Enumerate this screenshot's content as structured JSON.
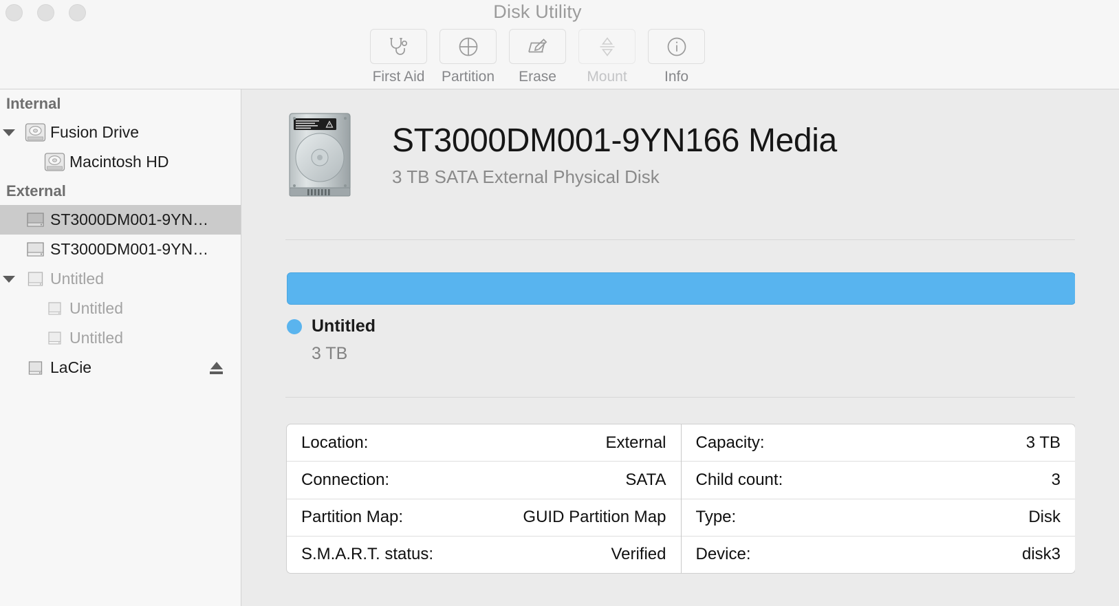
{
  "window": {
    "title": "Disk Utility",
    "traffic_lights": [
      "close-button",
      "minimize-button",
      "zoom-button"
    ]
  },
  "toolbar": {
    "items": [
      {
        "label": "First Aid",
        "icon": "stethoscope-icon",
        "enabled": true
      },
      {
        "label": "Partition",
        "icon": "pie-chart-icon",
        "enabled": true
      },
      {
        "label": "Erase",
        "icon": "erase-pencil-icon",
        "enabled": true
      },
      {
        "label": "Mount",
        "icon": "mount-arrows-icon",
        "enabled": false
      },
      {
        "label": "Info",
        "icon": "info-circle-icon",
        "enabled": true
      }
    ]
  },
  "sidebar": {
    "sections": [
      {
        "header": "Internal",
        "items": [
          {
            "label": "Fusion Drive",
            "indent": 0,
            "icon": "internal-disk-icon",
            "twisty": "expanded",
            "selected": false,
            "dim": false,
            "eject": false
          },
          {
            "label": "Macintosh HD",
            "indent": 1,
            "icon": "internal-volume-icon",
            "twisty": "none",
            "selected": false,
            "dim": false,
            "eject": false
          }
        ]
      },
      {
        "header": "External",
        "items": [
          {
            "label": "ST3000DM001-9YN…",
            "indent": 0,
            "icon": "external-disk-icon",
            "twisty": "none",
            "selected": true,
            "dim": false,
            "eject": false
          },
          {
            "label": "ST3000DM001-9YN…",
            "indent": 0,
            "icon": "external-disk-icon",
            "twisty": "none",
            "selected": false,
            "dim": false,
            "eject": false
          },
          {
            "label": "Untitled",
            "indent": 0,
            "icon": "external-volume-icon",
            "twisty": "expanded",
            "selected": false,
            "dim": true,
            "eject": false
          },
          {
            "label": "Untitled",
            "indent": 1,
            "icon": "external-volume-icon",
            "twisty": "none",
            "selected": false,
            "dim": true,
            "eject": false
          },
          {
            "label": "Untitled",
            "indent": 1,
            "icon": "external-volume-icon",
            "twisty": "none",
            "selected": false,
            "dim": true,
            "eject": false
          },
          {
            "label": "LaCie",
            "indent": 0,
            "icon": "external-volume-icon",
            "twisty": "none",
            "selected": false,
            "dim": false,
            "eject": true
          }
        ]
      }
    ]
  },
  "main": {
    "disk_title": "ST3000DM001-9YN166 Media",
    "disk_subtitle": "3 TB SATA External Physical Disk",
    "capacity": {
      "bar_color": "#5ab4ee",
      "segments": [
        {
          "name": "Untitled",
          "size": "3 TB",
          "percent": 100,
          "color": "#5ab4ee"
        }
      ]
    },
    "info": {
      "left": [
        {
          "key": "Location:",
          "value": "External"
        },
        {
          "key": "Connection:",
          "value": "SATA"
        },
        {
          "key": "Partition Map:",
          "value": "GUID Partition Map"
        },
        {
          "key": "S.M.A.R.T. status:",
          "value": "Verified"
        }
      ],
      "right": [
        {
          "key": "Capacity:",
          "value": "3 TB"
        },
        {
          "key": "Child count:",
          "value": "3"
        },
        {
          "key": "Type:",
          "value": "Disk"
        },
        {
          "key": "Device:",
          "value": "disk3"
        }
      ]
    }
  }
}
